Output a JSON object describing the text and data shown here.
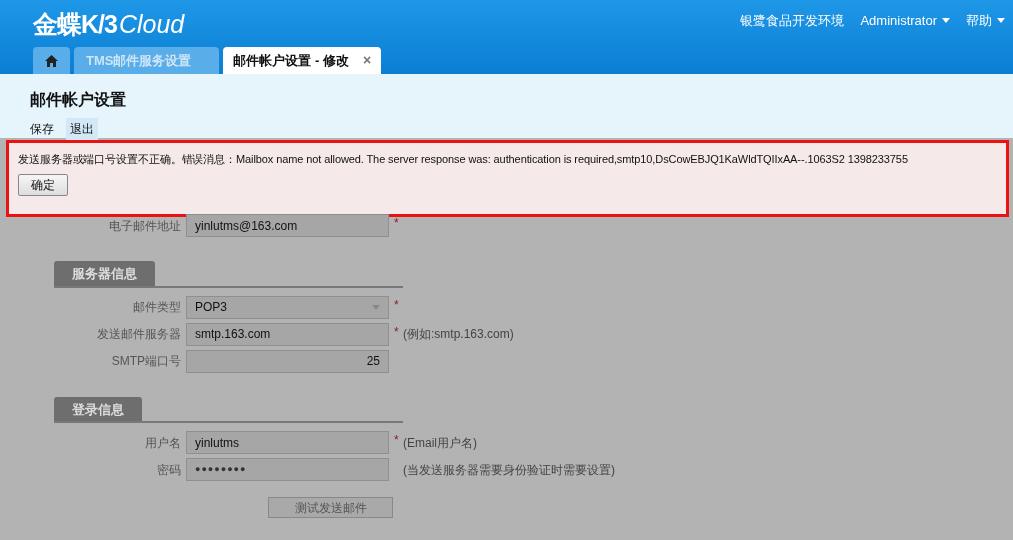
{
  "header": {
    "logo": {
      "main": "金蝶K/3",
      "suffix": "Cloud"
    },
    "links": [
      {
        "label": "银鹭食品开发环境",
        "dropdown": false
      },
      {
        "label": "Administrator",
        "dropdown": true
      },
      {
        "label": "帮助",
        "dropdown": true
      }
    ]
  },
  "tabs": [
    {
      "kind": "home",
      "selected": false,
      "closable": false
    },
    {
      "kind": "page",
      "label": "TMS邮件服务设置",
      "selected": false,
      "closable": false
    },
    {
      "kind": "page",
      "label": "邮件帐户设置 - 修改",
      "selected": true,
      "closable": true,
      "close": "×"
    }
  ],
  "page_title": "邮件帐户设置",
  "toolbar": [
    {
      "label": "保存",
      "highlighted": false
    },
    {
      "label": "退出",
      "highlighted": true
    }
  ],
  "dialog": {
    "message": "发送服务器或端口号设置不正确。错误消息：Mailbox name not allowed. The server response was: authentication is required,smtp10,DsCowEBJQ1KaWldTQIIxAA--.1063S2 1398233755",
    "button": "确定"
  },
  "form": {
    "rows": [
      {
        "kind": "text",
        "label": "电子邮件地址",
        "value": "yinlutms@163.com",
        "required_mark": "*"
      }
    ],
    "sections": [
      {
        "title": "服务器信息",
        "rows": [
          {
            "kind": "select",
            "label": "邮件类型",
            "value": "POP3",
            "required_mark": "*"
          },
          {
            "kind": "text",
            "label": "发送邮件服务器",
            "value": "smtp.163.com",
            "required_mark": "*",
            "hint": "(例如:smtp.163.com)"
          },
          {
            "kind": "number",
            "label": "SMTP端口号",
            "value": "25"
          }
        ]
      },
      {
        "title": "登录信息",
        "rows": [
          {
            "kind": "text",
            "label": "用户名",
            "value": "yinlutms",
            "required_mark": "*",
            "hint": "(Email用户名)"
          },
          {
            "kind": "password",
            "label": "密码",
            "value": "●●●●●●●●",
            "hint": "(当发送服务器需要身份验证时需要设置)"
          }
        ]
      }
    ],
    "button": "测试发送邮件"
  }
}
